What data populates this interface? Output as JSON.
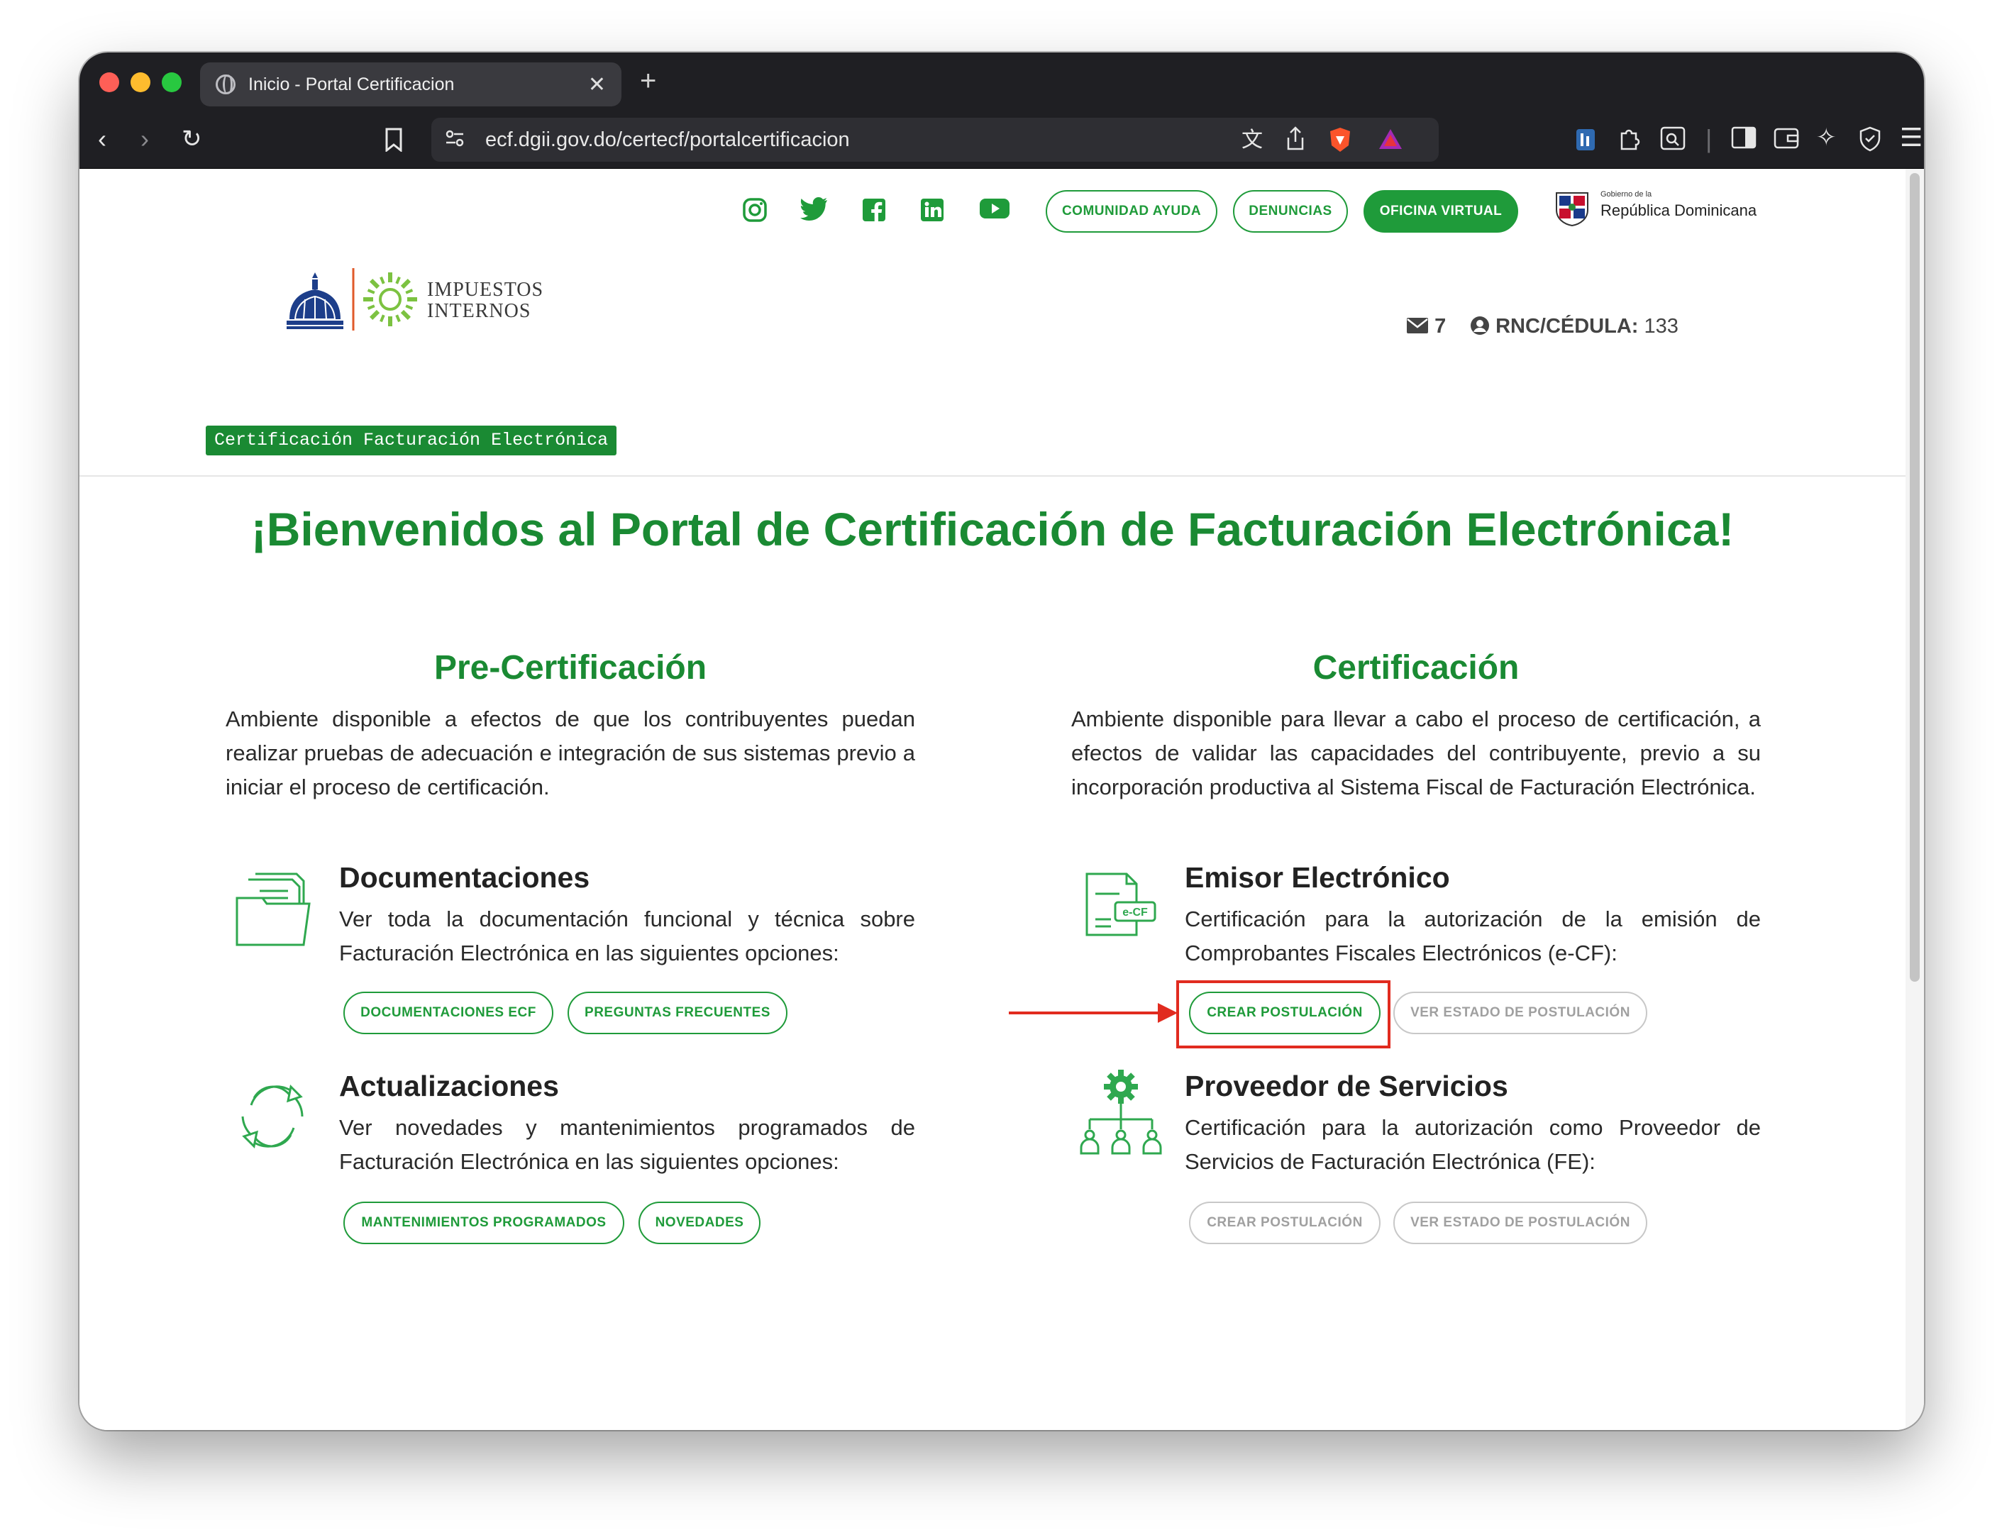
{
  "browser": {
    "tab_title": "Inicio - Portal Certificacion",
    "url": "ecf.dgii.gov.do/certecf/portalcertificacion"
  },
  "header": {
    "social": [
      "instagram-icon",
      "twitter-icon",
      "facebook-icon",
      "linkedin-icon",
      "youtube-icon"
    ],
    "buttons": {
      "comunidad": "COMUNIDAD AYUDA",
      "denuncias": "DENUNCIAS",
      "oficina": "OFICINA VIRTUAL"
    },
    "gov_small": "Gobierno de la",
    "gov_big": "República Dominicana",
    "logo_line1": "IMPUESTOS",
    "logo_line2": "INTERNOS",
    "messages_count": "7",
    "rnc_label": "RNC/CÉDULA:",
    "rnc_value": "133",
    "badge": "Certificación Facturación Electrónica"
  },
  "main": {
    "welcome": "¡Bienvenidos al Portal de Certificación de Facturación Electrónica!",
    "pre": {
      "title": "Pre-Certificación",
      "description": "Ambiente disponible a efectos de que los contribuyentes puedan realizar pruebas de adecuación e integración de sus sistemas previo a iniciar el proceso de certificación.",
      "documentaciones": {
        "title": "Documentaciones",
        "description": "Ver toda la documentación funcional y técnica sobre Facturación Electrónica en las siguientes opciones:",
        "btn_docs": "DOCUMENTACIONES ECF",
        "btn_faq": "PREGUNTAS FRECUENTES"
      },
      "actualizaciones": {
        "title": "Actualizaciones",
        "description": "Ver novedades y mantenimientos programados de Facturación Electrónica en las siguientes opciones:",
        "btn_mant": "MANTENIMIENTOS PROGRAMADOS",
        "btn_nov": "NOVEDADES"
      }
    },
    "cert": {
      "title": "Certificación",
      "description": "Ambiente disponible para llevar a cabo el proceso de certificación, a efectos de validar las capacidades del contribuyente, previo a su incorporación productiva al Sistema Fiscal de Facturación Electrónica.",
      "emisor": {
        "title": "Emisor Electrónico",
        "description": "Certificación para la autorización de la emisión de Comprobantes Fiscales Electrónicos (e-CF):",
        "btn_crear": "CREAR POSTULACIÓN",
        "btn_estado": "VER ESTADO DE POSTULACIÓN",
        "icon_label": "e-CF"
      },
      "proveedor": {
        "title": "Proveedor de Servicios",
        "description": "Certificación para la autorización como Proveedor de Servicios de Facturación Electrónica (FE):",
        "btn_crear": "CREAR POSTULACIÓN",
        "btn_estado": "VER ESTADO DE POSTULACIÓN"
      }
    }
  },
  "colors": {
    "brand_green": "#1a8a33",
    "button_green": "#1f9b3a",
    "annotation_red": "#e12b1f"
  }
}
